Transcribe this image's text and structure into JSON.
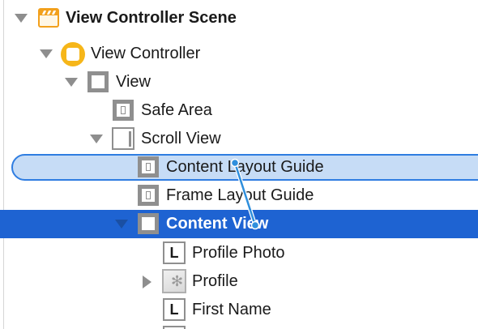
{
  "outline": {
    "scene_title": "View Controller Scene",
    "items": [
      {
        "label": "View Controller"
      },
      {
        "label": "View"
      },
      {
        "label": "Safe Area"
      },
      {
        "label": "Scroll View"
      },
      {
        "label": "Content Layout Guide"
      },
      {
        "label": "Frame Layout Guide"
      },
      {
        "label": "Content View"
      },
      {
        "label": "Profile Photo"
      },
      {
        "label": "Profile"
      },
      {
        "label": "First Name"
      }
    ]
  },
  "colors": {
    "selection": "#1e63d2",
    "drop_target": "#c6dcf6",
    "drop_target_border": "#2f7de1",
    "connector": "#2f8fdd",
    "scene_icon": "#f2a01c",
    "view_controller_icon": "#f6b619"
  },
  "icons": {
    "scene": "storyboard-scene-icon",
    "view_controller": "view-controller-icon",
    "view": "view-icon",
    "scroll_view": "scroll-view-icon",
    "layout_guide": "layout-guide-icon",
    "label": "label-icon",
    "image": "image-view-icon",
    "disclosure_open": "disclosure-triangle-down-icon",
    "disclosure_closed": "disclosure-triangle-right-icon"
  }
}
